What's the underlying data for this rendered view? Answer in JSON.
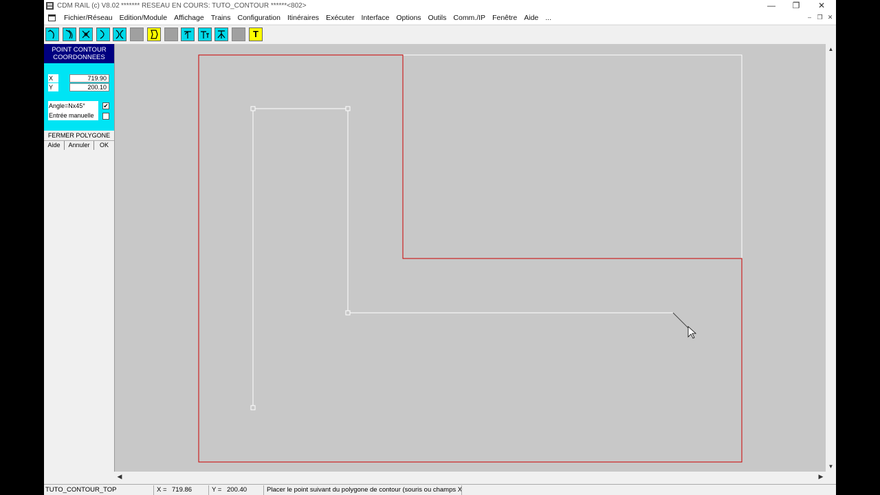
{
  "titlebar": {
    "app_title": "CDM RAIL (c) V8.02",
    "doc_title": "******* RESEAU EN COURS: TUTO_CONTOUR ******<802>",
    "minimize": "—",
    "restore": "❐",
    "close": "✕"
  },
  "menubar": {
    "items": [
      "Fichier/Réseau",
      "Edition/Module",
      "Affichage",
      "Trains",
      "Configuration",
      "Itinéraires",
      "Exécuter",
      "Interface",
      "Options",
      "Outils",
      "Comm./IP",
      "Fenêtre",
      "Aide",
      "..."
    ],
    "mdi_minimize": "–",
    "mdi_restore": "❐",
    "mdi_close": "✕"
  },
  "toolbar": {
    "text_tool_glyph": "T"
  },
  "panel": {
    "title_line1": "POINT CONTOUR",
    "title_line2": "COORDONNEES",
    "x_label": "X",
    "x_value": "719.90",
    "y_label": "Y",
    "y_value": "200.10",
    "angle_label": "Angle=Nx45°",
    "angle_checked": "✔",
    "manual_label": "Entrée manuelle",
    "manual_checked": "",
    "close_polygon": "FERMER POLYGONE",
    "help": "Aide",
    "cancel": "Annuler",
    "ok": "OK"
  },
  "scroll": {
    "up": "▲",
    "down": "▼",
    "left": "◀",
    "right": "▶"
  },
  "statusbar": {
    "network": "TUTO_CONTOUR_TOP",
    "x_label": "X =",
    "x_value": "719.86",
    "y_label": "Y =",
    "y_value": "200.40",
    "message": "Placer le point suivant du polygone de contour (souris ou champs X"
  },
  "colors": {
    "canvas_bg": "#c8c8c8",
    "contour_red": "#cc0000",
    "polygon_white": "#ffffff",
    "panel_cyan": "#00e4f4",
    "panel_header": "#000080",
    "tool_yellow": "#ffff00"
  }
}
